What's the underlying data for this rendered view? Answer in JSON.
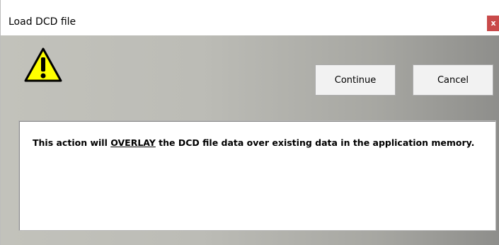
{
  "window": {
    "title": "Load DCD file",
    "close_label": "x"
  },
  "icons": {
    "warning": "warning-triangle-icon"
  },
  "buttons": {
    "continue_label": "Continue",
    "cancel_label": "Cancel"
  },
  "message": {
    "prefix": "This action will ",
    "emphasis": "OVERLAY",
    "suffix": " the DCD file data over existing data in the application memory."
  },
  "colors": {
    "close_button": "#c94a4a",
    "warning_fill": "#ffff00"
  }
}
